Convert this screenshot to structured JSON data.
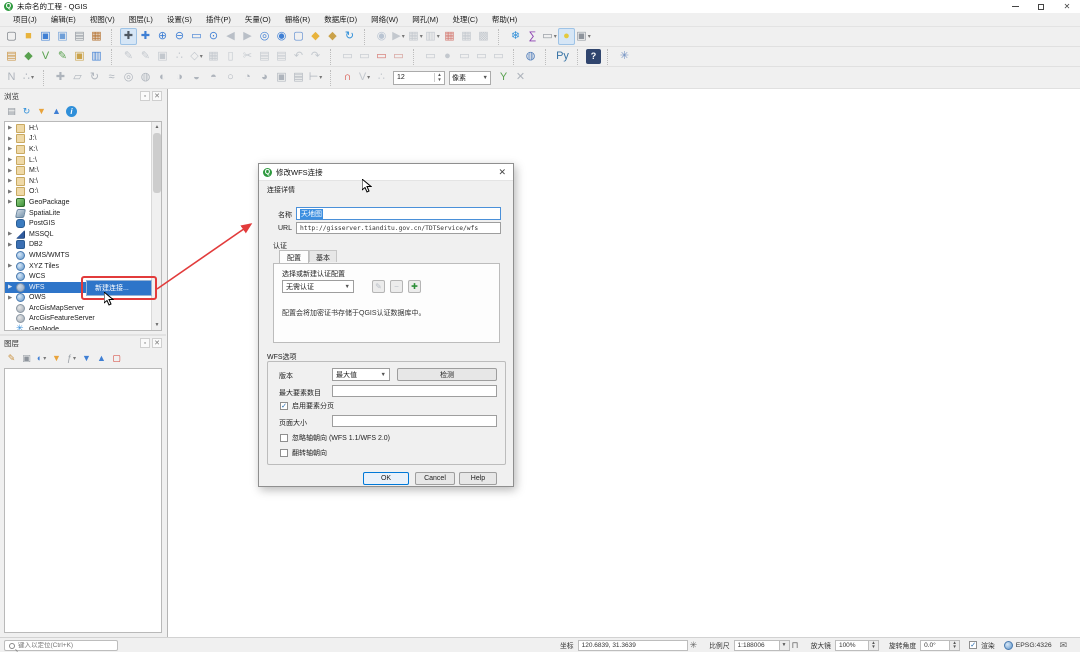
{
  "window": {
    "title": "未命名的工程 - QGIS"
  },
  "menu": {
    "items": [
      "项目(J)",
      "编辑(E)",
      "视图(V)",
      "图层(L)",
      "设置(S)",
      "插件(P)",
      "矢量(O)",
      "栅格(R)",
      "数据库(D)",
      "网络(W)",
      "网孔(M)",
      "处理(C)",
      "帮助(H)"
    ]
  },
  "toolbars": {
    "row1": [
      {
        "name": "new-project-button",
        "glyph": "▢",
        "fg": "#6f757c"
      },
      {
        "name": "open-project-button",
        "glyph": "■",
        "fg": "#e8b33c"
      },
      {
        "name": "save-project-button",
        "glyph": "▣",
        "fg": "#3f7fd4"
      },
      {
        "name": "save-project-as-button",
        "glyph": "▣",
        "fg": "#6f9fd8"
      },
      {
        "name": "new-print-layout-button",
        "glyph": "▤",
        "fg": "#8d939b"
      },
      {
        "name": "style-manager-button",
        "glyph": "▦",
        "fg": "#b5722f"
      },
      {
        "sep": true
      },
      {
        "name": "pan-map-button",
        "glyph": "✚",
        "fg": "#4e5862",
        "cls": "pressed"
      },
      {
        "name": "pan-to-selection-button",
        "glyph": "✚",
        "fg": "#3f7fd4"
      },
      {
        "name": "zoom-in-button",
        "glyph": "⊕",
        "fg": "#3f7fd4"
      },
      {
        "name": "zoom-out-button",
        "glyph": "⊖",
        "fg": "#3f7fd4"
      },
      {
        "name": "zoom-full-button",
        "glyph": "▭",
        "fg": "#3f7fd4"
      },
      {
        "name": "zoom-to-selection-button",
        "glyph": "⊙",
        "fg": "#3f7fd4"
      },
      {
        "name": "zoom-last-button",
        "glyph": "◀",
        "fg": "#b9bfc7",
        "cls": "disabled"
      },
      {
        "name": "zoom-next-button",
        "glyph": "▶",
        "fg": "#b9bfc7",
        "cls": "disabled"
      },
      {
        "name": "zoom-to-layer-button",
        "glyph": "◎",
        "fg": "#3f7fd4"
      },
      {
        "name": "zoom-to-native-button",
        "glyph": "◉",
        "fg": "#3f7fd4"
      },
      {
        "name": "new-map-view-button",
        "glyph": "▢",
        "fg": "#5b8bd0"
      },
      {
        "name": "new-bookmark-button",
        "glyph": "◆",
        "fg": "#e8b33c"
      },
      {
        "name": "show-bookmarks-button",
        "glyph": "◆",
        "fg": "#caa24a"
      },
      {
        "name": "refresh-button",
        "glyph": "↻",
        "fg": "#2f8fd9"
      },
      {
        "sep": true
      },
      {
        "name": "identify-features-button",
        "glyph": "◉",
        "fg": "#b9c4d2",
        "cls": "disabled"
      },
      {
        "name": "run-feature-action-button",
        "glyph": "▶",
        "fg": "#c3c8ce",
        "cls": "disabled",
        "dd": true
      },
      {
        "name": "select-features-button",
        "glyph": "▦",
        "fg": "#c3c8ce",
        "cls": "disabled",
        "dd": true
      },
      {
        "name": "select-by-expression-button",
        "glyph": "▥",
        "fg": "#c3c8ce",
        "cls": "disabled",
        "dd": true
      },
      {
        "name": "deselect-features-button",
        "glyph": "▦",
        "fg": "#d47c74"
      },
      {
        "name": "open-attribute-table-button",
        "glyph": "▦",
        "fg": "#c3c8ce",
        "cls": "disabled"
      },
      {
        "name": "field-calculator-button",
        "glyph": "▩",
        "fg": "#c3c8ce",
        "cls": "disabled"
      },
      {
        "sep": true
      },
      {
        "name": "temporal-controller-button",
        "glyph": "❄",
        "fg": "#2f8fd9"
      },
      {
        "name": "statistics-button",
        "glyph": "∑",
        "fg": "#8a3fb0"
      },
      {
        "name": "measure-button",
        "glyph": "▭",
        "fg": "#8d939b",
        "dd": true
      },
      {
        "name": "map-tips-button",
        "glyph": "●",
        "fg": "#e4c93e",
        "cls": "pressed"
      },
      {
        "name": "text-annotation-button",
        "glyph": "▣",
        "fg": "#8d939b",
        "dd": true
      }
    ],
    "row2": [
      {
        "name": "open-data-source-manager-button",
        "glyph": "▤",
        "fg": "#c9913e"
      },
      {
        "name": "new-geopackage-layer-button",
        "glyph": "◆",
        "fg": "#59a14f"
      },
      {
        "name": "new-shapefile-layer-button",
        "glyph": "V",
        "fg": "#59a14f"
      },
      {
        "name": "new-spatialite-layer-button",
        "glyph": "✎",
        "fg": "#59a14f"
      },
      {
        "name": "new-memory-layer-button",
        "glyph": "▣",
        "fg": "#caa24a"
      },
      {
        "name": "new-virtual-layer-button",
        "glyph": "▥",
        "fg": "#3f7fd4"
      },
      {
        "sep": true
      },
      {
        "name": "current-edits-button",
        "glyph": "✎",
        "fg": "#c3c8ce",
        "cls": "disabled"
      },
      {
        "name": "toggle-editing-button",
        "glyph": "✎",
        "fg": "#c3c8ce",
        "cls": "disabled"
      },
      {
        "name": "save-layer-edits-button",
        "glyph": "▣",
        "fg": "#c3c8ce",
        "cls": "disabled"
      },
      {
        "name": "add-feature-button",
        "glyph": "∴",
        "fg": "#c3c8ce",
        "cls": "disabled"
      },
      {
        "name": "vertex-tool-button",
        "glyph": "◇",
        "fg": "#c3c8ce",
        "cls": "disabled",
        "dd": true
      },
      {
        "name": "modify-attributes-button",
        "glyph": "▦",
        "fg": "#c3c8ce",
        "cls": "disabled"
      },
      {
        "name": "delete-selected-button",
        "glyph": "▯",
        "fg": "#c3c8ce",
        "cls": "disabled"
      },
      {
        "name": "cut-features-button",
        "glyph": "✂",
        "fg": "#c3c8ce",
        "cls": "disabled"
      },
      {
        "name": "copy-features-button",
        "glyph": "▤",
        "fg": "#c3c8ce",
        "cls": "disabled"
      },
      {
        "name": "paste-features-button",
        "glyph": "▤",
        "fg": "#c3c8ce",
        "cls": "disabled"
      },
      {
        "name": "undo-button",
        "glyph": "↶",
        "fg": "#c3c8ce",
        "cls": "disabled"
      },
      {
        "name": "redo-button",
        "glyph": "↷",
        "fg": "#c3c8ce",
        "cls": "disabled"
      },
      {
        "sep": true
      },
      {
        "name": "highlight-pinned-labels-button",
        "glyph": "▭",
        "fg": "#c3c8ce",
        "cls": "disabled"
      },
      {
        "name": "pin-labels-button",
        "glyph": "▭",
        "fg": "#c3c8ce",
        "cls": "disabled"
      },
      {
        "name": "show-hidden-labels-button",
        "glyph": "▭",
        "fg": "#d4716a"
      },
      {
        "name": "move-label-button",
        "glyph": "▭",
        "fg": "#d49a94"
      },
      {
        "sep": true
      },
      {
        "name": "layer-labeling-button",
        "glyph": "▭",
        "fg": "#c3c8ce",
        "cls": "disabled"
      },
      {
        "name": "layer-diagram-button",
        "glyph": "●",
        "fg": "#c3c8ce",
        "cls": "disabled"
      },
      {
        "name": "rotate-label-button",
        "glyph": "▭",
        "fg": "#c3c8ce",
        "cls": "disabled"
      },
      {
        "name": "change-label-button",
        "glyph": "▭",
        "fg": "#c3c8ce",
        "cls": "disabled"
      },
      {
        "name": "label-properties-button",
        "glyph": "▭",
        "fg": "#c3c8ce",
        "cls": "disabled"
      },
      {
        "sep": true
      },
      {
        "name": "metasearch-button",
        "glyph": "◍",
        "fg": "#4b79b8"
      },
      {
        "sep": true
      },
      {
        "name": "python-console-button",
        "glyph": "Py",
        "fg": "#3673a5"
      },
      {
        "sep": true
      },
      {
        "name": "help-contents-button",
        "glyph": "?",
        "fg": "#ffffff",
        "cls": "darkbtn"
      },
      {
        "sep": true
      },
      {
        "name": "topology-checker-button",
        "glyph": "✳",
        "fg": "#6f8fc0"
      }
    ],
    "row3a": [
      {
        "name": "cad-tools-button",
        "glyph": "N",
        "fg": "#aeb4bc",
        "cls": "disabled"
      },
      {
        "name": "construction-mode-button",
        "glyph": "∴",
        "fg": "#aeb4bc",
        "cls": "disabled",
        "dd": true
      },
      {
        "sep": true
      },
      {
        "name": "move-feature-button",
        "glyph": "✚",
        "fg": "#aeb4bc",
        "cls": "disabled"
      },
      {
        "name": "copy-move-feature-button",
        "glyph": "▱",
        "fg": "#aeb4bc",
        "cls": "disabled"
      },
      {
        "name": "rotate-feature-button",
        "glyph": "↻",
        "fg": "#aeb4bc",
        "cls": "disabled"
      },
      {
        "name": "simplify-feature-button",
        "glyph": "≈",
        "fg": "#aeb4bc",
        "cls": "disabled"
      },
      {
        "name": "add-ring-button",
        "glyph": "◎",
        "fg": "#aeb4bc",
        "cls": "disabled"
      },
      {
        "name": "add-part-button",
        "glyph": "◍",
        "fg": "#aeb4bc",
        "cls": "disabled"
      },
      {
        "name": "fill-ring-button",
        "glyph": "◐",
        "fg": "#aeb4bc",
        "cls": "disabled"
      },
      {
        "name": "delete-ring-button",
        "glyph": "◑",
        "fg": "#aeb4bc",
        "cls": "disabled"
      },
      {
        "name": "delete-part-button",
        "glyph": "◒",
        "fg": "#aeb4bc",
        "cls": "disabled"
      },
      {
        "name": "reshape-features-button",
        "glyph": "◓",
        "fg": "#aeb4bc",
        "cls": "disabled"
      },
      {
        "name": "offset-curve-button",
        "glyph": "○",
        "fg": "#aeb4bc",
        "cls": "disabled"
      },
      {
        "name": "split-features-button",
        "glyph": "◔",
        "fg": "#aeb4bc",
        "cls": "disabled"
      },
      {
        "name": "split-parts-button",
        "glyph": "◕",
        "fg": "#aeb4bc",
        "cls": "disabled"
      },
      {
        "name": "merge-features-button",
        "glyph": "▣",
        "fg": "#aeb4bc",
        "cls": "disabled"
      },
      {
        "name": "merge-attributes-button",
        "glyph": "▤",
        "fg": "#aeb4bc",
        "cls": "disabled"
      },
      {
        "name": "trim-extend-button",
        "glyph": "⊢",
        "fg": "#aeb4bc",
        "cls": "disabled",
        "dd": true
      },
      {
        "sep": true
      },
      {
        "name": "snapping-toggle-button",
        "glyph": "∩",
        "fg": "#d43b2f"
      },
      {
        "name": "snapping-mode-button",
        "glyph": "V",
        "fg": "#c3c8ce",
        "cls": "disabled",
        "dd": true
      },
      {
        "name": "snapping-type-button",
        "glyph": "∴",
        "fg": "#c3c8ce",
        "cls": "disabled"
      }
    ],
    "row3b": [
      {
        "name": "topological-editing-button",
        "glyph": "Y",
        "fg": "#59a14f"
      },
      {
        "name": "snapping-on-intersection-button",
        "glyph": "✕",
        "fg": "#aeb4bc"
      }
    ],
    "snapping_tolerance": "12",
    "snapping_units": "像素"
  },
  "browser": {
    "title": "浏览",
    "toolbar": [
      {
        "name": "add-selected-layers-button",
        "glyph": "▤",
        "fg": "#8d939b"
      },
      {
        "name": "refresh-browser-button",
        "glyph": "↻",
        "fg": "#2f8fd9"
      },
      {
        "name": "filter-browser-button",
        "glyph": "▼",
        "fg": "#e8a33c"
      },
      {
        "name": "collapse-all-button",
        "glyph": "▲",
        "fg": "#3f7fd4"
      },
      {
        "name": "browser-properties-button",
        "glyph": "i",
        "fg": "#ffffff",
        "cls": "roundbtn"
      }
    ],
    "items": [
      {
        "name": "browser-item-h-drive",
        "label": "H:\\",
        "chip": "folder",
        "expand": true
      },
      {
        "name": "browser-item-j-drive",
        "label": "J:\\",
        "chip": "folder",
        "expand": true
      },
      {
        "name": "browser-item-k-drive",
        "label": "K:\\",
        "chip": "folder",
        "expand": true
      },
      {
        "name": "browser-item-l-drive",
        "label": "L:\\",
        "chip": "folder",
        "expand": true
      },
      {
        "name": "browser-item-m-drive",
        "label": "M:\\",
        "chip": "folder",
        "expand": true
      },
      {
        "name": "browser-item-n-drive",
        "label": "N:\\",
        "chip": "folder",
        "expand": true
      },
      {
        "name": "browser-item-o-drive",
        "label": "O:\\",
        "chip": "folder",
        "expand": true
      },
      {
        "name": "browser-item-geopackage",
        "label": "GeoPackage",
        "chip": "geopackage",
        "expand": true
      },
      {
        "name": "browser-item-spatialite",
        "label": "SpatiaLite",
        "chip": "spatialite"
      },
      {
        "name": "browser-item-postgis",
        "label": "PostGIS",
        "chip": "postgis"
      },
      {
        "name": "browser-item-mssql",
        "label": "MSSQL",
        "chip": "mssql",
        "expand": true
      },
      {
        "name": "browser-item-db2",
        "label": "DB2",
        "chip": "db2",
        "expand": true
      },
      {
        "name": "browser-item-wms-wmts",
        "label": "WMS/WMTS",
        "chip": "globe"
      },
      {
        "name": "browser-item-xyz-tiles",
        "label": "XYZ Tiles",
        "chip": "globe",
        "expand": true
      },
      {
        "name": "browser-item-wcs",
        "label": "WCS",
        "chip": "globe"
      },
      {
        "name": "browser-item-wfs",
        "label": "WFS",
        "chip": "globe-dim",
        "cls": "selected",
        "expand": true
      },
      {
        "name": "browser-item-ows",
        "label": "OWS",
        "chip": "globe",
        "expand": true
      },
      {
        "name": "browser-item-arcgismapserver",
        "label": "ArcGisMapServer",
        "chip": "globe-gray"
      },
      {
        "name": "browser-item-arcgisfeatureserver",
        "label": "ArcGisFeatureServer",
        "chip": "globe-gray"
      },
      {
        "name": "browser-item-geonode",
        "label": "GeoNode",
        "chip": "snowflake"
      }
    ]
  },
  "layers_panel": {
    "title": "图层",
    "toolbar": [
      {
        "name": "open-layer-styling-button",
        "glyph": "✎",
        "fg": "#c9913e"
      },
      {
        "name": "add-group-button",
        "glyph": "▣",
        "fg": "#8d939b"
      },
      {
        "name": "manage-map-themes-button",
        "glyph": "◐",
        "fg": "#3f7fd4",
        "dd": true
      },
      {
        "name": "filter-legend-button",
        "glyph": "▼",
        "fg": "#e8a33c"
      },
      {
        "name": "filter-by-expression-button",
        "glyph": "ƒ",
        "fg": "#9aa0a6",
        "dd": true
      },
      {
        "name": "expand-all-button",
        "glyph": "▼",
        "fg": "#3f7fd4"
      },
      {
        "name": "collapse-all-layers-button",
        "glyph": "▲",
        "fg": "#3f7fd4"
      },
      {
        "name": "remove-layer-button",
        "glyph": "▢",
        "fg": "#d43b2f"
      }
    ]
  },
  "context_menu": {
    "new_connection_label": "新建连接..."
  },
  "dialog": {
    "title": "修改WFS连接",
    "connection_details_label": "连接详情",
    "name_label": "名称",
    "name_value": "天地图",
    "url_label": "URL",
    "url_value": "http://gisserver.tianditu.gov.cn/TDTService/wfs",
    "auth_label": "认证",
    "tab_config": "配置",
    "tab_basic": "基本",
    "auth_select_label": "选择或新建认证配置",
    "auth_combo_value": "无需认证",
    "auth_note": "配置会将加密证书存储于QGIS认证数据库中。",
    "wfs_options_label": "WFS选项",
    "version_label": "版本",
    "version_value": "最大值",
    "detect_button": "检测",
    "max_features_label": "最大要素数目",
    "paging_label": "启用要素分页",
    "page_size_label": "页面大小",
    "ignore_axis_label": "忽略轴朝向 (WFS 1.1/WFS 2.0)",
    "invert_axis_label": "翻转轴朝向",
    "ok_button": "OK",
    "cancel_button": "Cancel",
    "help_button": "Help"
  },
  "statusbar": {
    "locator_placeholder": "键入以定位(Ctrl+K)",
    "coord_label": "坐标",
    "coord_value": "120.6839, 31.3639",
    "scale_label": "比例尺",
    "scale_value": "1:188006",
    "magnifier_label": "放大镜",
    "magnifier_value": "100%",
    "rotation_label": "旋转角度",
    "rotation_value": "0.0°",
    "render_label": "渲染",
    "crs_label": "EPSG:4326"
  },
  "colors": {
    "selection_blue": "#2e75c9",
    "annotation_red": "#e23b3b",
    "qgis_green": "#2e9a3f"
  }
}
